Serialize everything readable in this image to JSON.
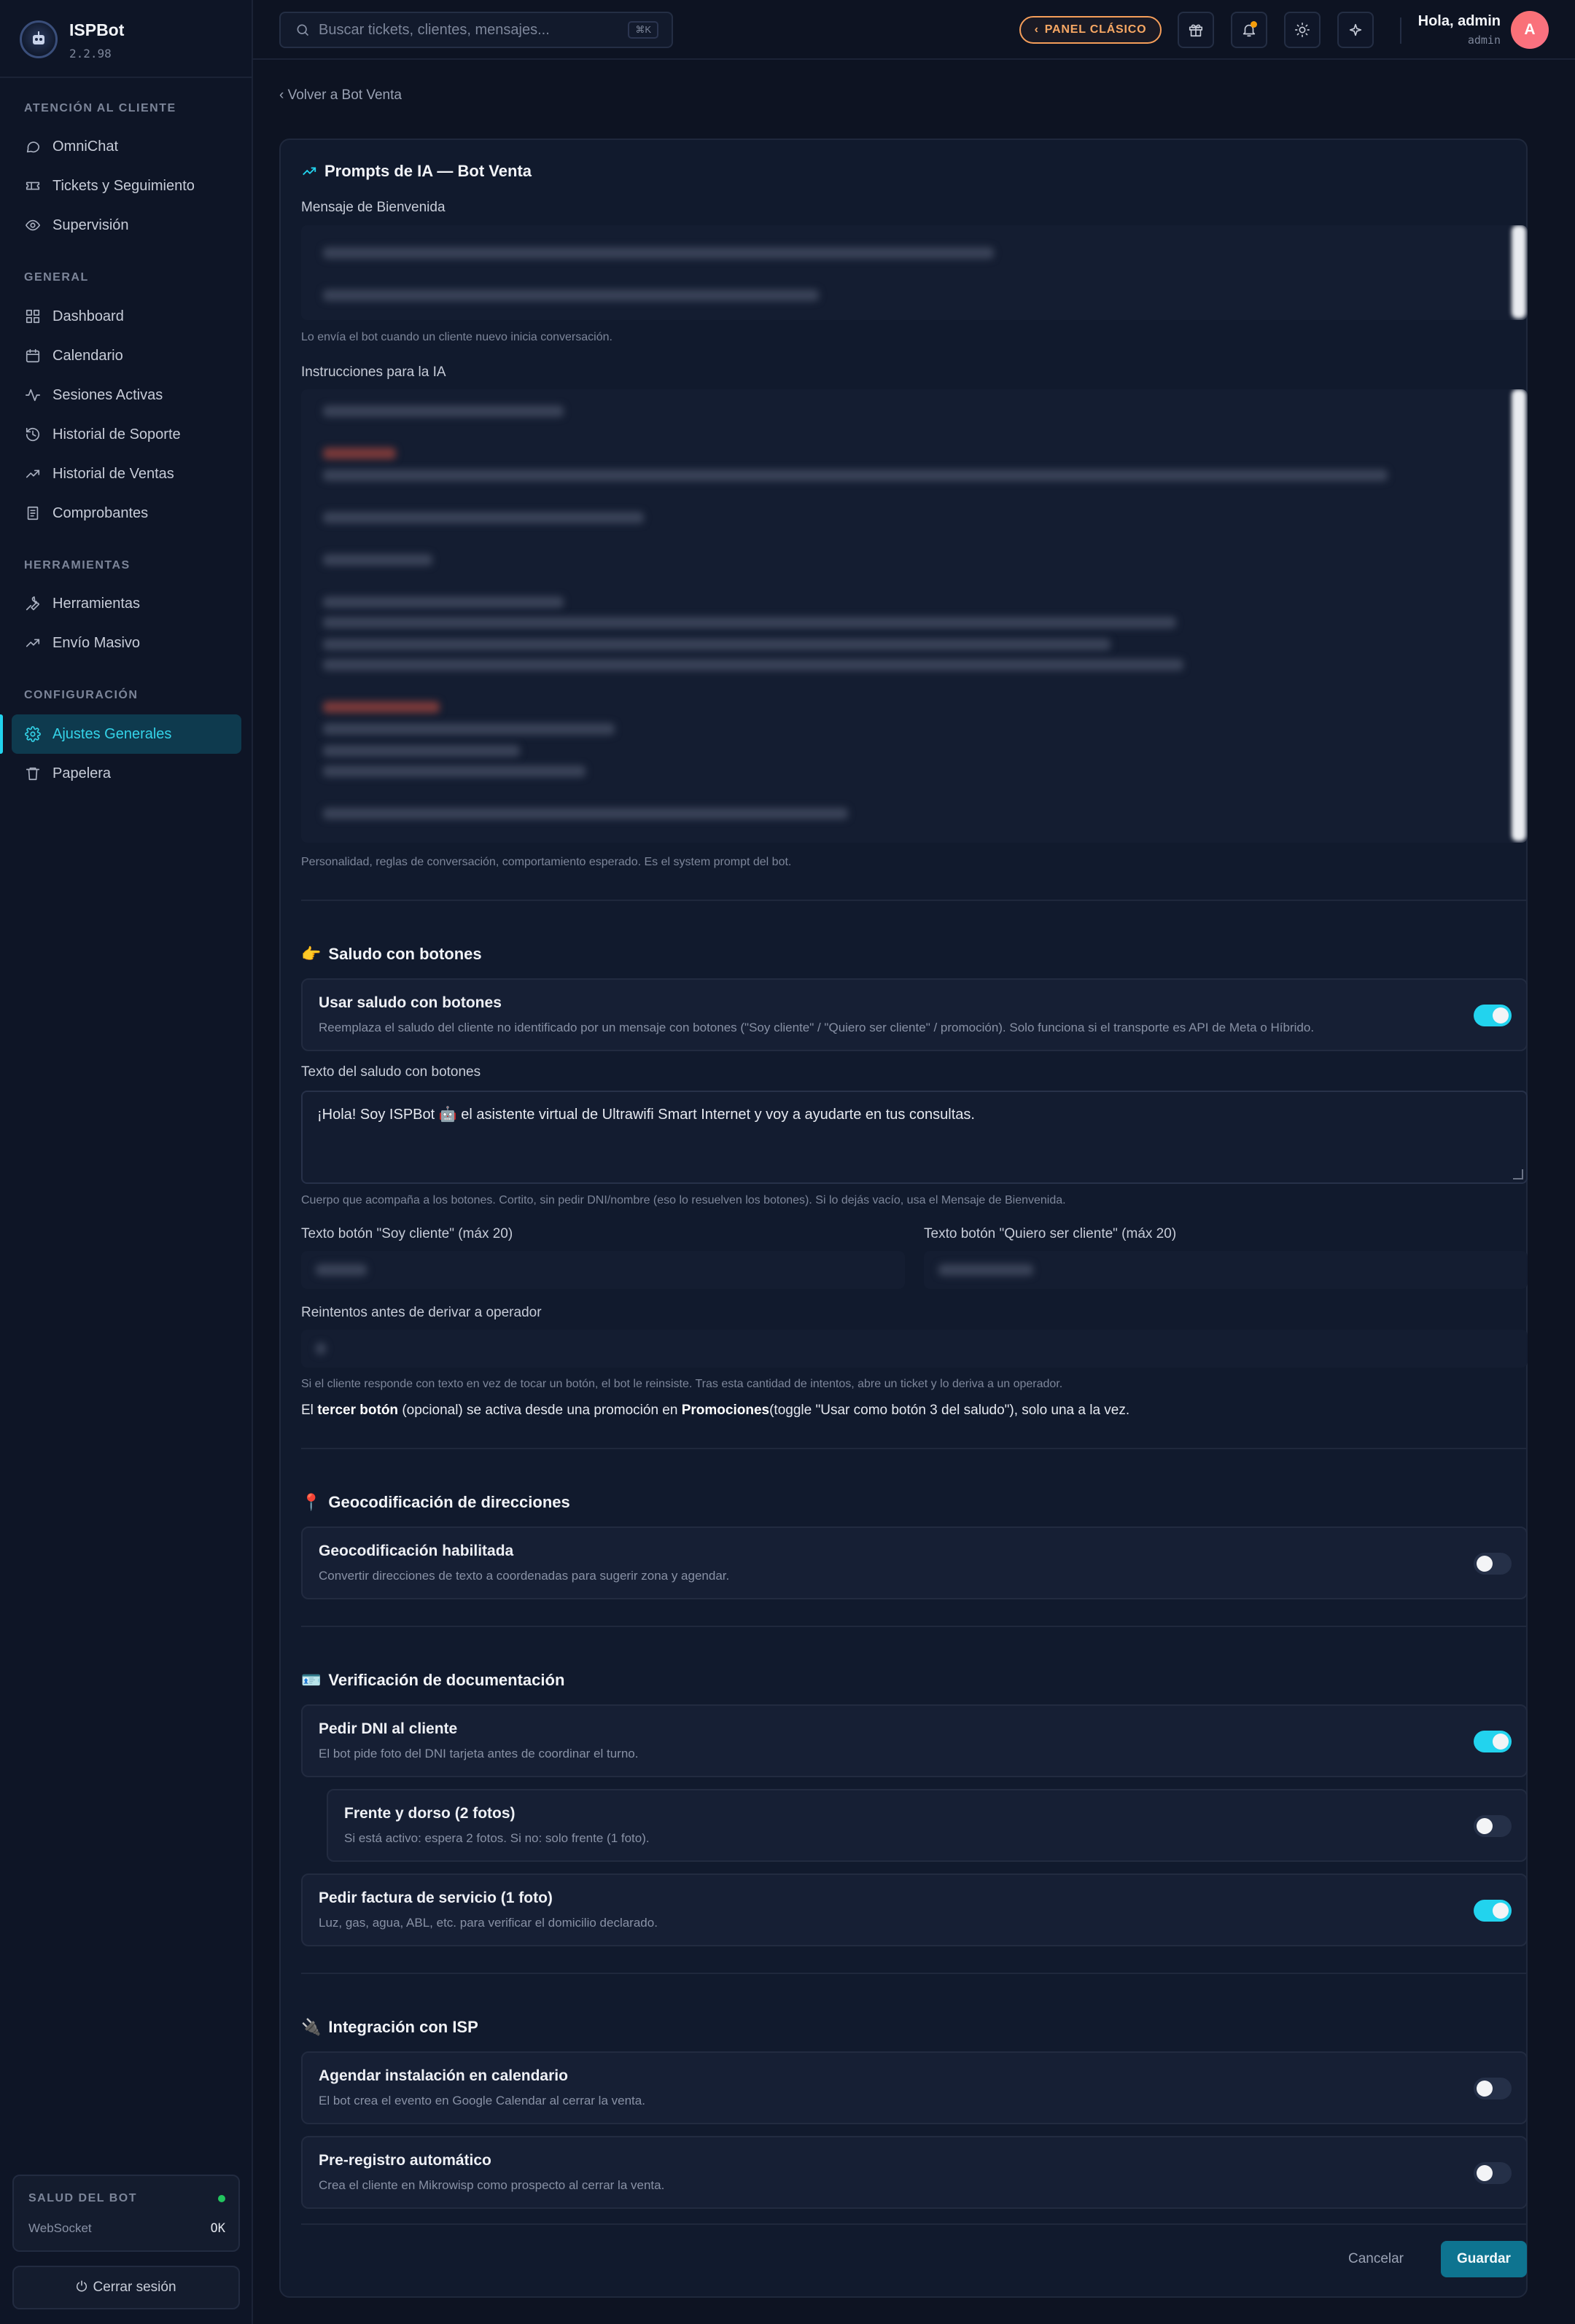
{
  "app": {
    "name": "ISPBot",
    "version": "2.2.98"
  },
  "sidebar": {
    "sections": [
      {
        "title": "ATENCIÓN AL CLIENTE"
      },
      {
        "title": "GENERAL"
      },
      {
        "title": "HERRAMIENTAS"
      },
      {
        "title": "CONFIGURACIÓN"
      }
    ],
    "items": [
      {
        "label": "OmniChat",
        "icon": "chat-icon"
      },
      {
        "label": "Tickets y Seguimiento",
        "icon": "ticket-icon"
      },
      {
        "label": "Supervisión",
        "icon": "eye-icon"
      },
      {
        "label": "Dashboard",
        "icon": "grid-icon"
      },
      {
        "label": "Calendario",
        "icon": "calendar-icon"
      },
      {
        "label": "Sesiones Activas",
        "icon": "activity-icon"
      },
      {
        "label": "Historial de Soporte",
        "icon": "history-icon"
      },
      {
        "label": "Historial de Ventas",
        "icon": "trending-up-icon"
      },
      {
        "label": "Comprobantes",
        "icon": "receipt-icon"
      },
      {
        "label": "Herramientas",
        "icon": "wrench-icon"
      },
      {
        "label": "Envío Masivo",
        "icon": "trending-up-icon"
      },
      {
        "label": "Ajustes Generales",
        "icon": "gear-icon",
        "active": true
      },
      {
        "label": "Papelera",
        "icon": "trash-icon"
      }
    ],
    "health": {
      "title": "SALUD DEL BOT",
      "key": "WebSocket",
      "value": "OK",
      "status_color": "#22c55e"
    },
    "logout_label": "Cerrar sesión"
  },
  "header": {
    "search_placeholder": "Buscar tickets, clientes, mensajes...",
    "search_shortcut": "⌘K",
    "classic_label": "PANEL CLÁSICO",
    "greeting": "Hola, admin",
    "role": "admin",
    "avatar_initial": "A"
  },
  "page": {
    "back_label": "‹ Volver a Bot Venta",
    "prompts": {
      "title": "Prompts de IA — Bot Venta",
      "welcome_label": "Mensaje de Bienvenida",
      "welcome_help": "Lo envía el bot cuando un cliente nuevo inicia conversación.",
      "instructions_label": "Instrucciones para la IA",
      "instructions_help": "Personalidad, reglas de conversación, comportamiento esperado. Es el system prompt del bot."
    },
    "greeting_buttons": {
      "title": "Saludo con botones",
      "title_emoji": "👉",
      "toggle_title": "Usar saludo con botones",
      "toggle_desc": "Reemplaza el saludo del cliente no identificado por un mensaje con botones (\"Soy cliente\" / \"Quiero ser cliente\" / promoción). Solo funciona si el transporte es API de Meta o Híbrido.",
      "toggle_on": true,
      "text_label": "Texto del saludo con botones",
      "text_value": "¡Hola! Soy ISPBot 🤖 el asistente virtual de Ultrawifi Smart Internet y voy a ayudarte en tus consultas.",
      "text_help": "Cuerpo que acompaña a los botones. Cortito, sin pedir DNI/nombre (eso lo resuelven los botones). Si lo dejás vacío, usa el Mensaje de Bienvenida.",
      "btn1_label": "Texto botón \"Soy cliente\" (máx 20)",
      "btn2_label": "Texto botón \"Quiero ser cliente\" (máx 20)",
      "retries_label": "Reintentos antes de derivar a operador",
      "retries_help": "Si el cliente responde con texto en vez de tocar un botón, el bot le reinsiste. Tras esta cantidad de intentos, abre un ticket y lo deriva a un operador.",
      "note_prefix": "El ",
      "note_bold1": "tercer botón",
      "note_mid": " (opcional) se activa desde una promoción en ",
      "note_bold2": "Promociones",
      "note_suffix": "(toggle \"Usar como botón 3 del saludo\"), solo una a la vez."
    },
    "geocoding": {
      "title": "Geocodificación de direcciones",
      "title_emoji": "📍",
      "toggle_title": "Geocodificación habilitada",
      "toggle_desc": "Convertir direcciones de texto a coordenadas para sugerir zona y agendar.",
      "toggle_on": false
    },
    "documentation": {
      "title": "Verificación de documentación",
      "title_emoji": "🪪",
      "items": [
        {
          "title": "Pedir DNI al cliente",
          "desc": "El bot pide foto del DNI tarjeta antes de coordinar el turno.",
          "on": true
        },
        {
          "title": "Frente y dorso (2 fotos)",
          "desc": "Si está activo: espera 2 fotos. Si no: solo frente (1 foto).",
          "on": false
        },
        {
          "title": "Pedir factura de servicio (1 foto)",
          "desc": "Luz, gas, agua, ABL, etc. para verificar el domicilio declarado.",
          "on": true
        }
      ]
    },
    "isp": {
      "title": "Integración con ISP",
      "title_emoji": "🔌",
      "items": [
        {
          "title": "Agendar instalación en calendario",
          "desc": "El bot crea el evento en Google Calendar al cerrar la venta.",
          "on": false
        },
        {
          "title": "Pre-registro automático",
          "desc": "Crea el cliente en Mikrowisp como prospecto al cerrar la venta.",
          "on": false
        }
      ]
    },
    "actions": {
      "cancel": "Cancelar",
      "save": "Guardar"
    }
  },
  "colors": {
    "accent": "#22d3ee",
    "classic_panel": "#f59e5a",
    "save_button": "#0e7490"
  }
}
